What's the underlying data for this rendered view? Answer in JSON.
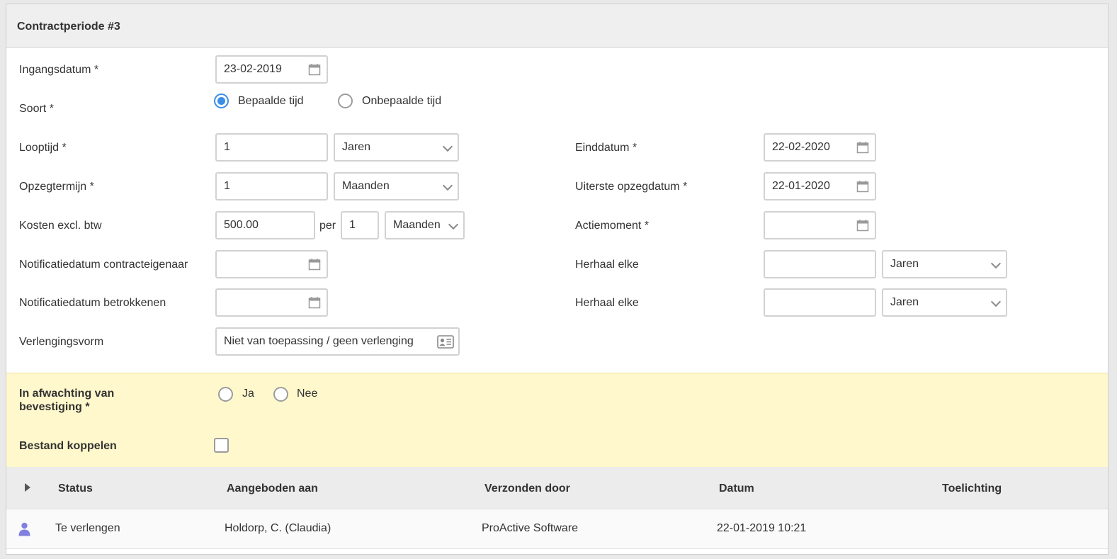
{
  "panel": {
    "title": "Contractperiode #3"
  },
  "form": {
    "ingangsdatum": {
      "label": "Ingangsdatum *",
      "value": "23-02-2019"
    },
    "soort": {
      "label": "Soort *",
      "options": [
        {
          "label": "Bepaalde tijd",
          "selected": true
        },
        {
          "label": "Onbepaalde tijd",
          "selected": false
        }
      ]
    },
    "looptijd": {
      "label": "Looptijd *",
      "value": "1",
      "unit": "Jaren"
    },
    "einddatum": {
      "label": "Einddatum *",
      "value": "22-02-2020"
    },
    "opzegtermijn": {
      "label": "Opzegtermijn *",
      "value": "1",
      "unit": "Maanden"
    },
    "uiterste_opzegdatum": {
      "label": "Uiterste opzegdatum *",
      "value": "22-01-2020"
    },
    "kosten": {
      "label": "Kosten excl. btw",
      "value": "500.00",
      "per_label": "per",
      "per_value": "1",
      "unit": "Maanden"
    },
    "actiemoment": {
      "label": "Actiemoment *",
      "value": ""
    },
    "notificatie_eigenaar": {
      "label": "Notificatiedatum contracteigenaar",
      "value": ""
    },
    "herhaal_1": {
      "label": "Herhaal elke",
      "value": "",
      "unit": "Jaren"
    },
    "notificatie_betrokkenen": {
      "label": "Notificatiedatum betrokkenen",
      "value": ""
    },
    "herhaal_2": {
      "label": "Herhaal elke",
      "value": "",
      "unit": "Jaren"
    },
    "verlengingsvorm": {
      "label": "Verlengingsvorm",
      "value": "Niet van toepassing / geen verlenging"
    }
  },
  "confirm": {
    "label_line1": "In afwachting van",
    "label_line2": "bevestiging *",
    "options": [
      {
        "label": "Ja",
        "selected": false
      },
      {
        "label": "Nee",
        "selected": false
      }
    ],
    "bestand_label": "Bestand koppelen",
    "bestand_checked": false
  },
  "table": {
    "columns": [
      "Status",
      "Aangeboden aan",
      "Verzonden door",
      "Datum",
      "Toelichting"
    ],
    "rows": [
      {
        "status": "Te verlengen",
        "aangeboden_aan": "Holdorp, C. (Claudia)",
        "verzonden_door": "ProActive Software",
        "datum": "22-01-2019 10:21",
        "toelichting": ""
      }
    ]
  },
  "colors": {
    "accent": "#3b8ee8",
    "highlight": "#fff8cc",
    "user_icon": "#8080e0"
  }
}
